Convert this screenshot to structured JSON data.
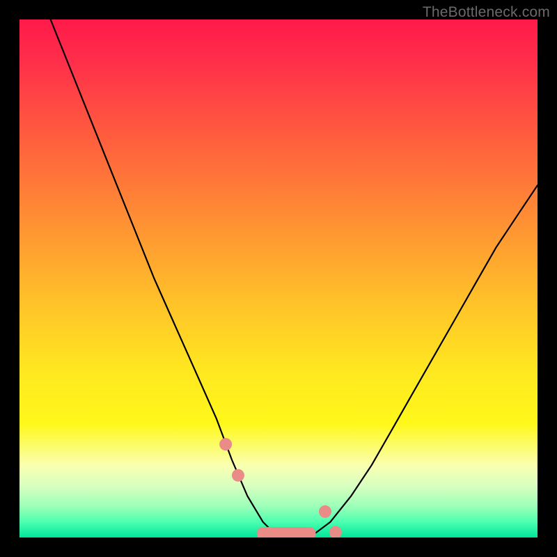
{
  "watermark": "TheBottleneck.com",
  "chart_data": {
    "type": "line",
    "title": "",
    "xlabel": "",
    "ylabel": "",
    "xlim": [
      0,
      100
    ],
    "ylim": [
      0,
      100
    ],
    "series": [
      {
        "name": "bottleneck-curve",
        "x": [
          6,
          10,
          14,
          18,
          22,
          26,
          30,
          34,
          38,
          41,
          44,
          47,
          50,
          53,
          56,
          60,
          64,
          68,
          72,
          76,
          80,
          84,
          88,
          92,
          96,
          100
        ],
        "values": [
          100,
          90,
          80,
          70,
          60,
          50,
          41,
          32,
          23,
          15,
          8,
          3,
          0,
          0,
          0,
          3,
          8,
          14,
          21,
          28,
          35,
          42,
          49,
          56,
          62,
          68
        ]
      }
    ],
    "markers": [
      {
        "name": "marker-left",
        "x": 41,
        "y": 15
      },
      {
        "name": "marker-right",
        "x": 60,
        "y": 3
      }
    ],
    "flat_segment": {
      "x_start": 47,
      "x_end": 56,
      "y": 0
    },
    "gradient_stops": [
      {
        "pos": 0.0,
        "color": "#ff1a4a"
      },
      {
        "pos": 0.5,
        "color": "#ffc628"
      },
      {
        "pos": 0.85,
        "color": "#faffb0"
      },
      {
        "pos": 1.0,
        "color": "#00e59a"
      }
    ]
  }
}
